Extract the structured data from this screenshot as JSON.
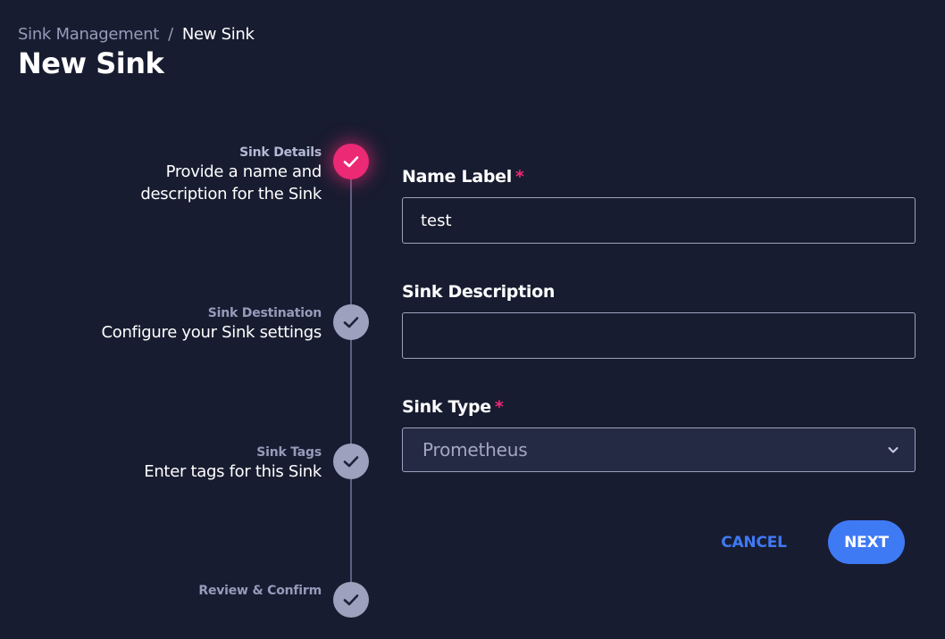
{
  "breadcrumb": {
    "parent": "Sink Management",
    "separator": "/",
    "current": "New Sink"
  },
  "page_title": "New Sink",
  "stepper": {
    "steps": [
      {
        "label": "Sink Details",
        "description_lines": [
          "Provide a name and",
          "description for the Sink"
        ],
        "state": "active",
        "icon": "check-icon"
      },
      {
        "label": "Sink Destination",
        "description_lines": [
          "Configure your Sink settings"
        ],
        "state": "complete",
        "icon": "check-icon"
      },
      {
        "label": "Sink Tags",
        "description_lines": [
          "Enter tags for this Sink"
        ],
        "state": "complete",
        "icon": "check-icon"
      },
      {
        "label": "Review & Confirm",
        "description_lines": [],
        "state": "complete",
        "icon": "check-icon"
      }
    ]
  },
  "form": {
    "name": {
      "label": "Name Label",
      "required_mark": "*",
      "value": "test"
    },
    "description": {
      "label": "Sink Description",
      "value": ""
    },
    "type": {
      "label": "Sink Type",
      "required_mark": "*",
      "selected": "Prometheus",
      "icon": "chevron-down-icon"
    }
  },
  "actions": {
    "cancel_label": "CANCEL",
    "next_label": "NEXT"
  },
  "colors": {
    "background": "#181c30",
    "accent_pink": "#ec2975",
    "primary_blue": "#3f7af5",
    "muted_text": "#969bbb"
  }
}
